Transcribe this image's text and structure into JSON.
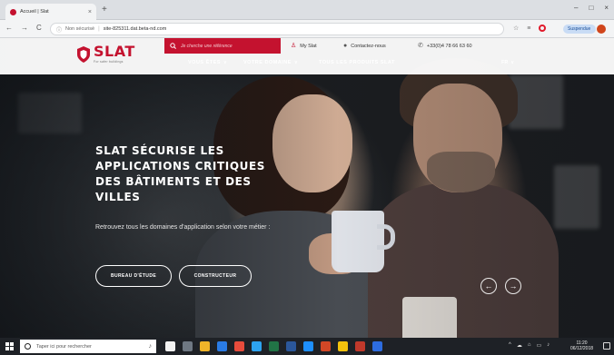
{
  "browser": {
    "tab_title": "Accueil | Slat",
    "tab_close": "×",
    "new_tab": "+",
    "window_controls": [
      "–",
      "□",
      "×"
    ],
    "nav_buttons": [
      "←",
      "→",
      "C"
    ],
    "address_info": "ⓘ",
    "address_security": "Non sécurisé",
    "address_separator": "|",
    "address_url": "site-825311.dat.beta-nd.com",
    "toolbar_icons": [
      "☆",
      "≡"
    ],
    "subscribe_label": "Suspendue"
  },
  "site": {
    "brand": {
      "name": "SLAT",
      "tagline": "For safer buildings",
      "color": "#c4122f"
    },
    "search_placeholder": "Je cherche une référence",
    "utility_links": [
      {
        "icon": "person-icon",
        "glyph": "♙",
        "label": "My Slat"
      },
      {
        "icon": "chat-icon",
        "glyph": "●",
        "label": "Contactez-nous"
      },
      {
        "icon": "phone-icon",
        "glyph": "✆",
        "label": "+33(0)4 78 66 63 60"
      }
    ],
    "nav": [
      {
        "label": "VOUS ÊTES",
        "chevron": "∨"
      },
      {
        "label": "VOTRE DOMAINE",
        "chevron": "∨"
      },
      {
        "label": "TOUS LES PRODUITS SLAT",
        "chevron": ""
      }
    ],
    "language": {
      "label": "FR",
      "chevron": "∨"
    }
  },
  "hero": {
    "title": "SLAT SÉCURISE LES APPLICATIONS CRITIQUES DES BÂTIMENTS ET DES VILLES",
    "subtitle": "Retrouvez tous les domaines d'application selon votre métier :",
    "buttons": [
      "BUREAU D'ÉTUDE",
      "CONSTRUCTEUR"
    ],
    "prev_arrow": "←",
    "next_arrow": "→"
  },
  "taskbar": {
    "search_placeholder": "Taper ici pour rechercher",
    "mic": "♪",
    "app_colors": [
      "#f2f2f2",
      "#6f7883",
      "#f0b429",
      "#2a7be4",
      "#e74c3c",
      "#2da3f0",
      "#217346",
      "#2b579a",
      "#1e90ff",
      "#d24726",
      "#f4c20d",
      "#c0392b",
      "#2d6cdf"
    ],
    "tray_icons": [
      "^",
      "☁",
      "⌂",
      "▭",
      "♪"
    ],
    "clock_time": "11:20",
    "clock_date": "06/12/2018"
  }
}
